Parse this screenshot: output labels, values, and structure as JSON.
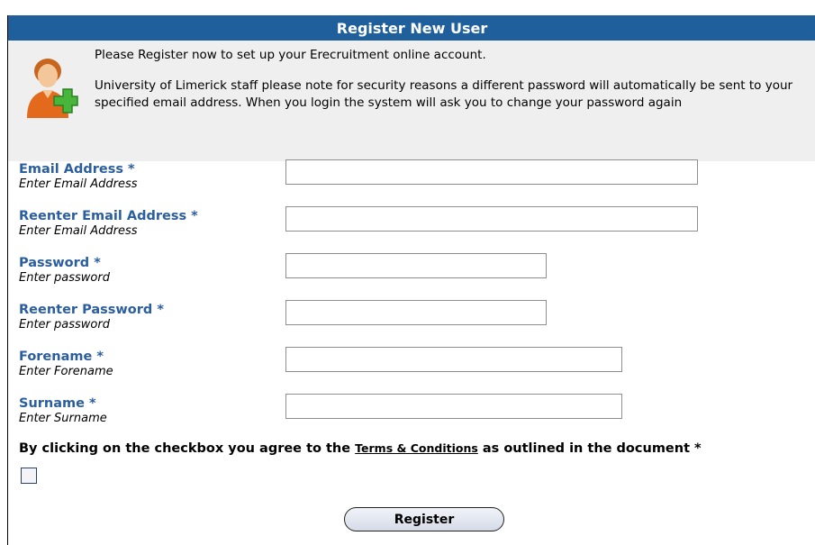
{
  "header": {
    "title": "Register New User"
  },
  "notice": {
    "line1": "Please Register now to set up your Erecruitment online account.",
    "line2": "University of Limerick staff please note for security reasons a different password will automatically be sent to your specified email address. When you login the system will ask you to change your password again"
  },
  "fields": {
    "email": {
      "label": "Email Address *",
      "hint": "Enter Email Address",
      "value": ""
    },
    "email_confirm": {
      "label": "Reenter Email Address *",
      "hint": "Enter Email Address",
      "value": ""
    },
    "password": {
      "label": "Password *",
      "hint": "Enter password",
      "value": ""
    },
    "password_confirm": {
      "label": "Reenter Password *",
      "hint": "Enter password",
      "value": ""
    },
    "forename": {
      "label": "Forename *",
      "hint": "Enter Forename",
      "value": ""
    },
    "surname": {
      "label": "Surname *",
      "hint": "Enter Surname",
      "value": ""
    }
  },
  "terms": {
    "before": "By clicking on the checkbox you agree to the ",
    "link": "Terms & Conditions",
    "after": " as outlined in the document *",
    "checked": false
  },
  "actions": {
    "register_label": "Register"
  },
  "icons": {
    "avatar": "user-add-icon"
  },
  "colors": {
    "header_bg": "#1f5f9c",
    "label": "#2b5e9e",
    "notice_bg": "#efefef"
  }
}
